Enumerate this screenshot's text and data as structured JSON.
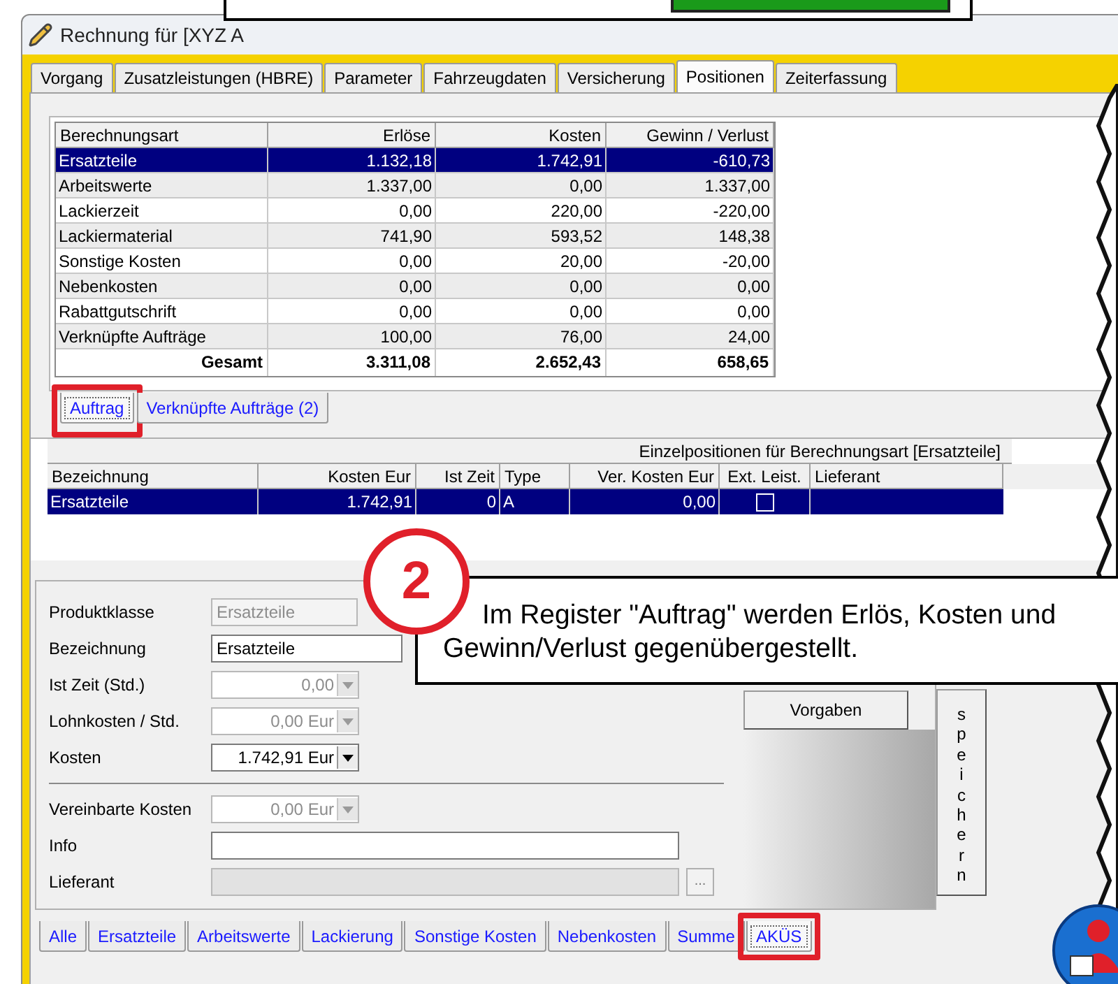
{
  "window": {
    "title": "Rechnung für [XYZ A"
  },
  "tabs": [
    {
      "label": "Vorgang",
      "selected": false
    },
    {
      "label": "Zusatzleistungen (HBRE)",
      "selected": false
    },
    {
      "label": "Parameter",
      "selected": false
    },
    {
      "label": "Fahrzeugdaten",
      "selected": false
    },
    {
      "label": "Versicherung",
      "selected": false
    },
    {
      "label": "Positionen",
      "selected": true
    },
    {
      "label": "Zeiterfassung",
      "selected": false
    }
  ],
  "summary_table": {
    "columns": [
      "Berechnungsart",
      "Erlöse",
      "Kosten",
      "Gewinn / Verlust"
    ],
    "rows": [
      {
        "cells": [
          "Ersatzteile",
          "1.132,18",
          "1.742,91",
          "-610,73"
        ],
        "selected": true
      },
      {
        "cells": [
          "Arbeitswerte",
          "1.337,00",
          "0,00",
          "1.337,00"
        ],
        "selected": false
      },
      {
        "cells": [
          "Lackierzeit",
          "0,00",
          "220,00",
          "-220,00"
        ],
        "selected": false
      },
      {
        "cells": [
          "Lackiermaterial",
          "741,90",
          "593,52",
          "148,38"
        ],
        "selected": false
      },
      {
        "cells": [
          "Sonstige Kosten",
          "0,00",
          "20,00",
          "-20,00"
        ],
        "selected": false
      },
      {
        "cells": [
          "Nebenkosten",
          "0,00",
          "0,00",
          "0,00"
        ],
        "selected": false
      },
      {
        "cells": [
          "Rabattgutschrift",
          "0,00",
          "0,00",
          "0,00"
        ],
        "selected": false
      },
      {
        "cells": [
          "Verknüpfte Aufträge",
          "100,00",
          "76,00",
          "24,00"
        ],
        "selected": false
      }
    ],
    "total": [
      "Gesamt",
      "3.311,08",
      "2.652,43",
      "658,65"
    ]
  },
  "sub_tabs": [
    {
      "label": "Auftrag",
      "selected": true,
      "highlighted": true
    },
    {
      "label": "Verknüpfte Aufträge (2)",
      "selected": false,
      "highlighted": false
    }
  ],
  "detail_table": {
    "caption": "Einzelpositionen für Berechnungsart [Ersatzteile]",
    "columns": [
      "Bezeichnung",
      "Kosten Eur",
      "Ist Zeit",
      "Type",
      "Ver. Kosten Eur",
      "Ext. Leist.",
      "Lieferant"
    ],
    "rows": [
      {
        "bezeichnung": "Ersatzteile",
        "kosten": "1.742,91",
        "ist_zeit": "0",
        "type": "A",
        "ver_kosten": "0,00",
        "ext_leist": false,
        "selected": true
      }
    ]
  },
  "callout": {
    "number": "2",
    "text": "Im Register \"Auftrag\" werden Erlös, Kosten und Gewinn/Verlust gegenübergestellt."
  },
  "form": {
    "fields": [
      {
        "label": "Produktklasse",
        "kind": "text",
        "value": "Ersatzteile",
        "disabled": true
      },
      {
        "label": "Bezeichnung",
        "kind": "text",
        "value": "Ersatzteile",
        "disabled": false
      },
      {
        "label": "Ist Zeit (Std.)",
        "kind": "dropdown",
        "value": "0,00",
        "disabled": true
      },
      {
        "label": "Lohnkosten / Std.",
        "kind": "dropdown",
        "value": "0,00 Eur",
        "disabled": true
      },
      {
        "label": "Kosten",
        "kind": "dropdown",
        "value": "1.742,91 Eur",
        "disabled": false
      },
      {
        "kind": "divider"
      },
      {
        "label": "Vereinbarte Kosten",
        "kind": "dropdown",
        "value": "0,00 Eur",
        "disabled": true
      },
      {
        "label": "Info",
        "kind": "text",
        "disabled": false
      },
      {
        "label": "Lieferant",
        "kind": "lookup",
        "disabled": true,
        "button": "..."
      }
    ]
  },
  "vorgaben_button": "Vorgaben",
  "save_button": "speichern",
  "bottom_tabs": [
    {
      "label": "Alle",
      "selected": false,
      "highlighted": false
    },
    {
      "label": "Ersatzteile",
      "selected": false,
      "highlighted": false
    },
    {
      "label": "Arbeitswerte",
      "selected": false,
      "highlighted": false
    },
    {
      "label": "Lackierung",
      "selected": false,
      "highlighted": false
    },
    {
      "label": "Sonstige Kosten",
      "selected": false,
      "highlighted": false
    },
    {
      "label": "Nebenkosten",
      "selected": false,
      "highlighted": false
    },
    {
      "label": "Summe",
      "selected": false,
      "highlighted": false
    },
    {
      "label": "AKÜS",
      "selected": true,
      "highlighted": true
    }
  ]
}
